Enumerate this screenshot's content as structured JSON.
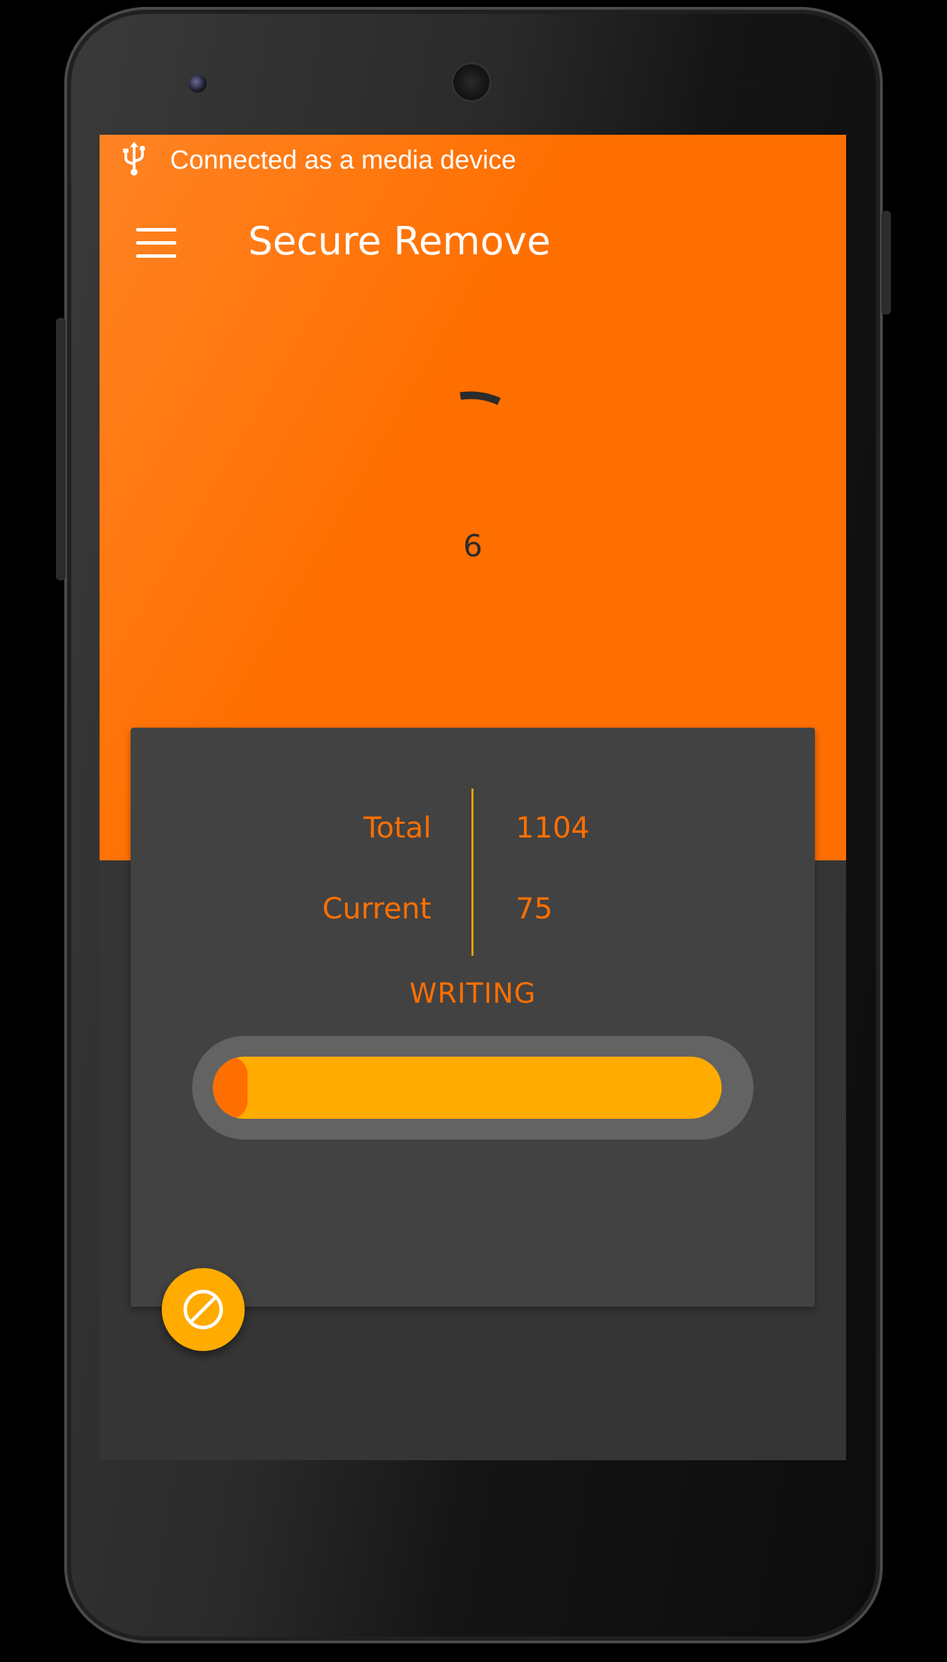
{
  "status_bar": {
    "icon": "usb-icon",
    "notification": "Connected as a media device"
  },
  "app_bar": {
    "menu_icon": "menu-icon",
    "title": "Secure Remove"
  },
  "progress_indicator": {
    "type": "indeterminate-spinner",
    "count": "6"
  },
  "stats": {
    "total_label": "Total",
    "total_value": "1104",
    "current_label": "Current",
    "current_value": "75"
  },
  "operation": {
    "state": "WRITING",
    "progress_fraction": 0.068
  },
  "fab": {
    "icon": "cancel-icon"
  },
  "colors": {
    "primary": "#ff6f00",
    "accent": "#ffab00",
    "background": "#353535",
    "card": "#424242"
  }
}
